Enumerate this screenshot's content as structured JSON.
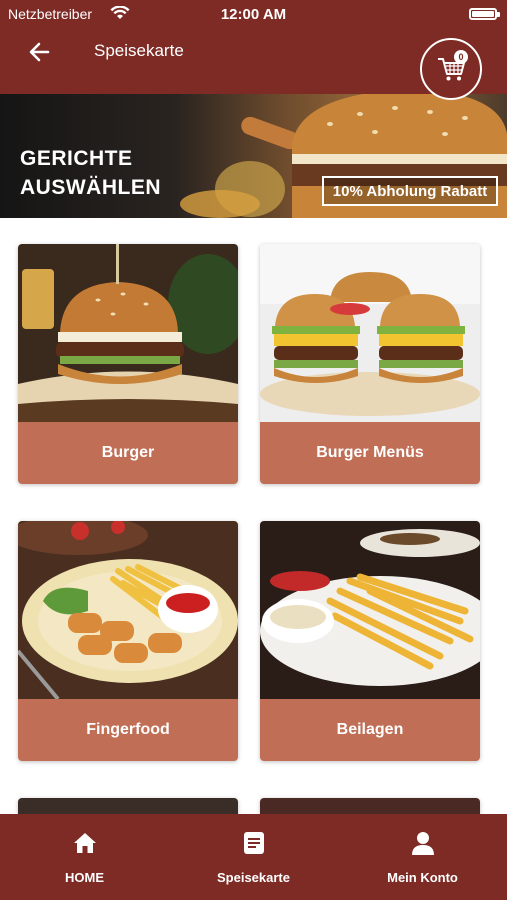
{
  "status_bar": {
    "carrier": "Netzbetreiber",
    "time": "12:00 AM"
  },
  "header": {
    "title": "Speisekarte",
    "cart_count": "0"
  },
  "banner": {
    "line1": "GERICHTE",
    "line2": "AUSWÄHLEN",
    "promo": "10% Abholung Rabatt"
  },
  "categories": [
    {
      "label": "Burger"
    },
    {
      "label": "Burger Menüs"
    },
    {
      "label": "Fingerfood"
    },
    {
      "label": "Beilagen"
    }
  ],
  "bottom_nav": [
    {
      "label": "HOME",
      "icon": "home-icon"
    },
    {
      "label": "Speisekarte",
      "icon": "menu-list-icon"
    },
    {
      "label": "Mein Konto",
      "icon": "user-icon"
    }
  ],
  "colors": {
    "primary": "#7e2a25",
    "accent": "#c06e55"
  }
}
